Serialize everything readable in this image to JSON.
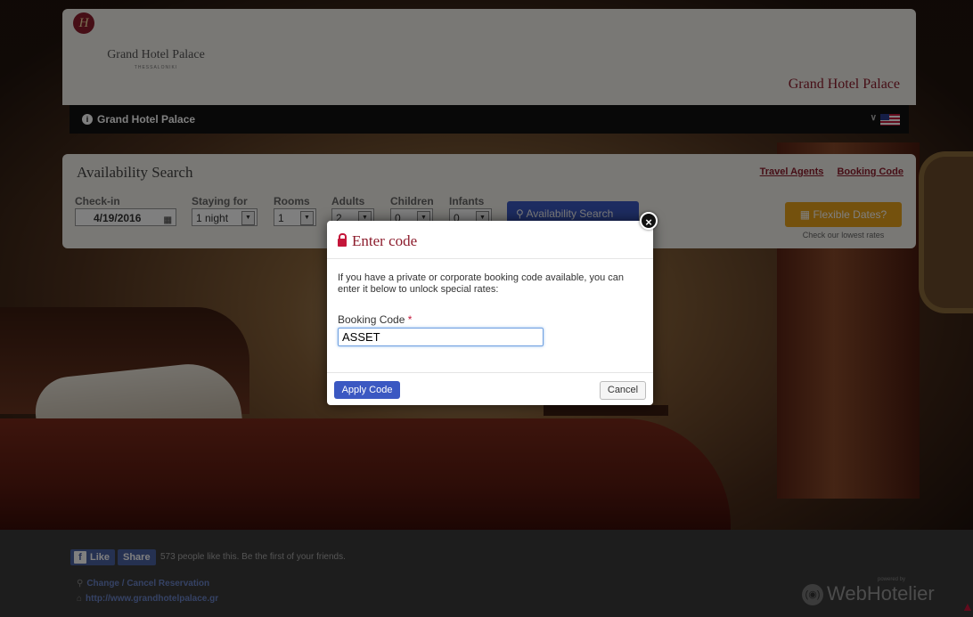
{
  "header": {
    "logo_mark": "H",
    "logo_name": "Grand Hotel Palace",
    "logo_city": "THESSALONIKI",
    "brand_title": "Grand Hotel Palace"
  },
  "navbar": {
    "label": "Grand Hotel Palace",
    "info_icon": "info-circle-icon",
    "language_flag": "us-flag-icon"
  },
  "availability": {
    "title": "Availability Search",
    "links": {
      "travel_agents": "Travel Agents",
      "booking_code": "Booking Code"
    },
    "checkin": {
      "label": "Check-in",
      "value": "4/19/2016"
    },
    "staying": {
      "label": "Staying for",
      "value": "1 night"
    },
    "rooms": {
      "label": "Rooms",
      "value": "1"
    },
    "adults": {
      "label": "Adults",
      "value": "2"
    },
    "children": {
      "label": "Children",
      "value": "0"
    },
    "infants": {
      "label": "Infants",
      "value": "0"
    },
    "search_button": "Availability Search",
    "flexible_button": "Flexible Dates?",
    "flexible_note": "Check our lowest rates"
  },
  "modal": {
    "title": "Enter code",
    "description": "If you have a private or corporate booking code available, you can enter it below to unlock special rates:",
    "field_label": "Booking Code",
    "required_mark": "*",
    "field_value": "ASSET",
    "apply_button": "Apply Code",
    "cancel_button": "Cancel",
    "close_symbol": "×"
  },
  "footer": {
    "fb_like": "Like",
    "fb_share": "Share",
    "fb_text": "573 people like this. Be the first of your friends.",
    "change_link": "Change / Cancel Reservation",
    "website_link": "http://www.grandhotelpalace.gr",
    "powered_by": "powered by",
    "webhotelier": "WebHotelier"
  },
  "colors": {
    "brand": "#8c1c2c",
    "primary_button": "#3b58c2",
    "accent_button": "#e8a21a",
    "navbar": "#111111"
  }
}
